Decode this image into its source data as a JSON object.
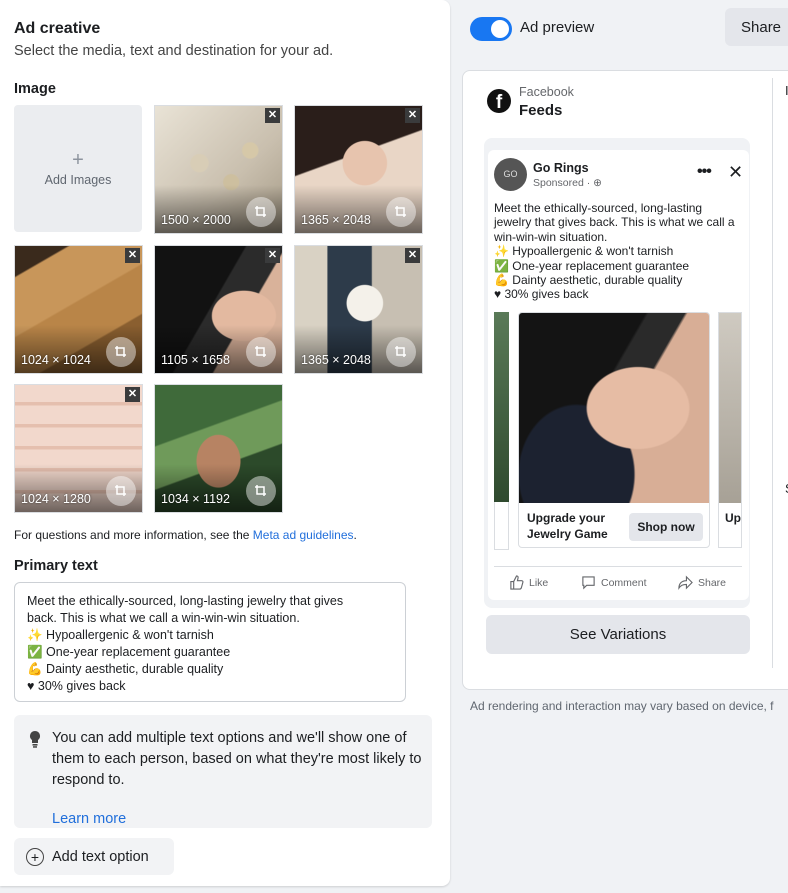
{
  "colors": {
    "accent": "#1877f2",
    "link": "#216fdb",
    "panel": "#ffffff",
    "background": "#f0f2f5"
  },
  "left": {
    "title": "Ad creative",
    "subtitle": "Select the media, text and destination for your ad.",
    "image_section": "Image",
    "add_images_label": "Add Images",
    "images": [
      {
        "dims": "1500 × 2000",
        "kind": "rings"
      },
      {
        "dims": "1365 × 2048",
        "kind": "portrait"
      },
      {
        "dims": "1024 × 1024",
        "kind": "tray"
      },
      {
        "dims": "1105 × 1658",
        "kind": "earring"
      },
      {
        "dims": "1365 × 2048",
        "kind": "cup"
      },
      {
        "dims": "1024 × 1280",
        "kind": "box"
      },
      {
        "dims": "1034 × 1192",
        "kind": "hands"
      }
    ],
    "guidelines_prefix": "For questions and more information, see the ",
    "guidelines_link": "Meta ad guidelines",
    "guidelines_suffix": ".",
    "primary_text_section": "Primary text",
    "primary_text_lines": [
      "Meet the ethically-sourced, long-lasting jewelry that gives",
      "back. This is what we call a win-win-win situation.",
      "✨ Hypoallergenic & won't tarnish",
      "✅ One-year replacement guarantee",
      "💪 Dainty aesthetic, durable quality",
      "♥ 30% gives back"
    ],
    "tip_text": "You can add multiple text options and we'll show one of them to each person, based on what they're most likely to respond to.",
    "tip_link": "Learn more",
    "add_text_option": "Add text option"
  },
  "right": {
    "preview_label": "Ad preview",
    "preview_toggle_on": true,
    "share_label": "Share",
    "platform": "Facebook",
    "placement": "Feeds",
    "post": {
      "page_name": "Go Rings",
      "avatar_text": "GO",
      "sponsored": "Sponsored · ⊕",
      "body_lines": [
        "Meet the ethically-sourced, long-lasting",
        "jewelry that gives back. This is what we call a",
        "win-win-win situation.",
        "✨ Hypoallergenic & won't tarnish",
        "✅ One-year replacement guarantee",
        "💪 Dainty aesthetic, durable quality",
        "♥ 30% gives back"
      ],
      "card_headline": "Upgrade your Jewelry Game",
      "card_cta": "Shop now",
      "peek_headline": "Up Jew",
      "like": "Like",
      "comment": "Comment",
      "share": "Share"
    },
    "see_variations": "See Variations",
    "strip_letters": [
      "I",
      "S"
    ],
    "disclaimer": "Ad rendering and interaction may vary based on device, f"
  }
}
